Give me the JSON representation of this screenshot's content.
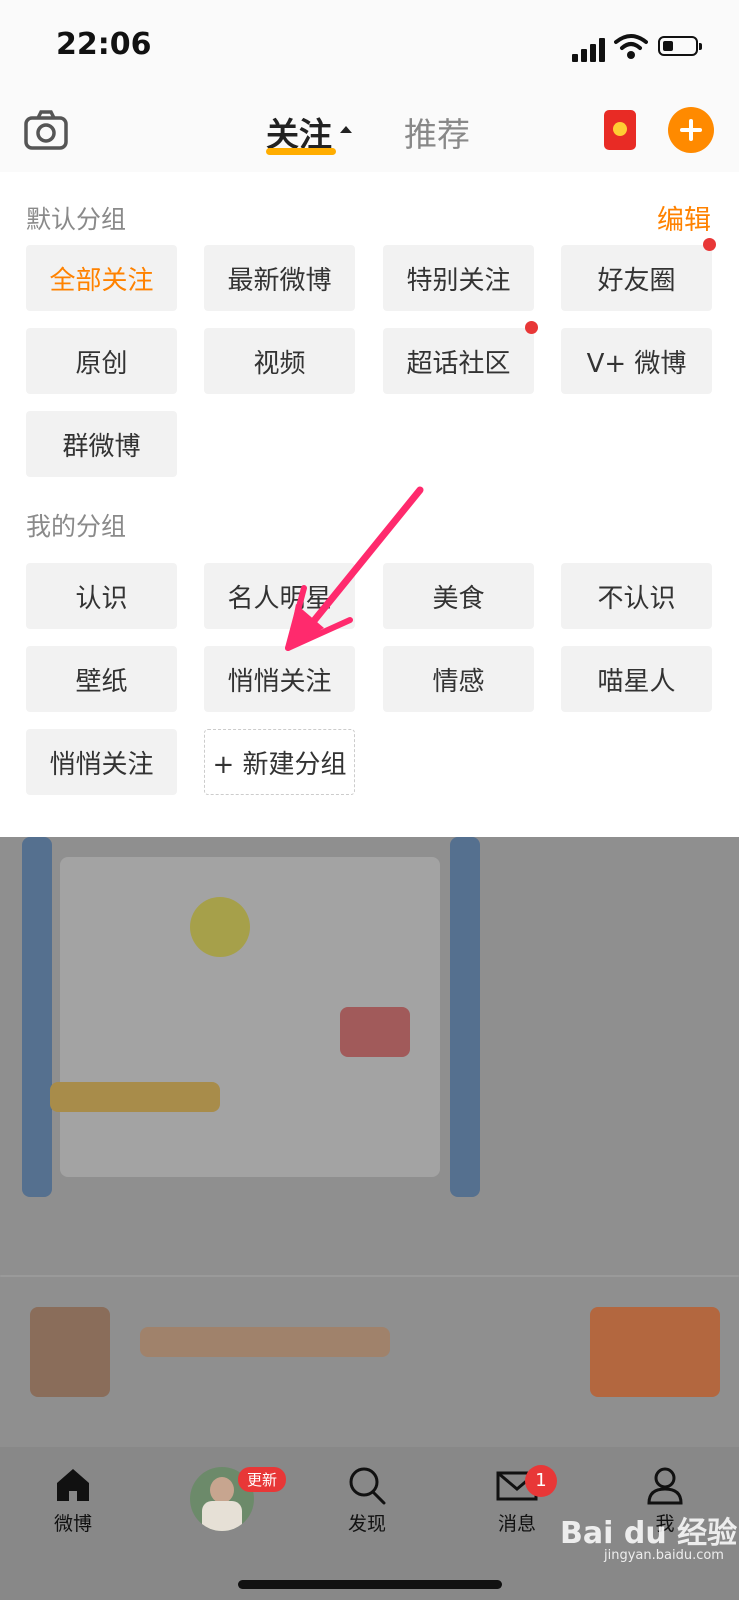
{
  "status_bar": {
    "time": "22:06"
  },
  "header": {
    "tab_follow": "关注",
    "tab_recommend": "推荐"
  },
  "default_group": {
    "title": "默认分组",
    "edit_label": "编辑",
    "chips": [
      "全部关注",
      "最新微博",
      "特别关注",
      "好友圈",
      "原创",
      "视频",
      "超话社区",
      "V+ 微博",
      "群微博"
    ]
  },
  "my_group": {
    "title": "我的分组",
    "chips": [
      "认识",
      "名人明星",
      "美食",
      "不认识",
      "壁纸",
      "悄悄关注",
      "情感",
      "喵星人",
      "悄悄关注"
    ],
    "new_group_label": "+ 新建分组"
  },
  "tabbar": {
    "home": "微博",
    "update_badge": "更新",
    "discover": "发现",
    "messages": "消息",
    "messages_badge": "1",
    "me": "我"
  },
  "watermark": {
    "brand": "Bai du 经验",
    "url": "jingyan.baidu.com"
  },
  "colors": {
    "accent": "#ff8200",
    "annotation_arrow": "#ff2a6d",
    "badge": "#e83737"
  }
}
